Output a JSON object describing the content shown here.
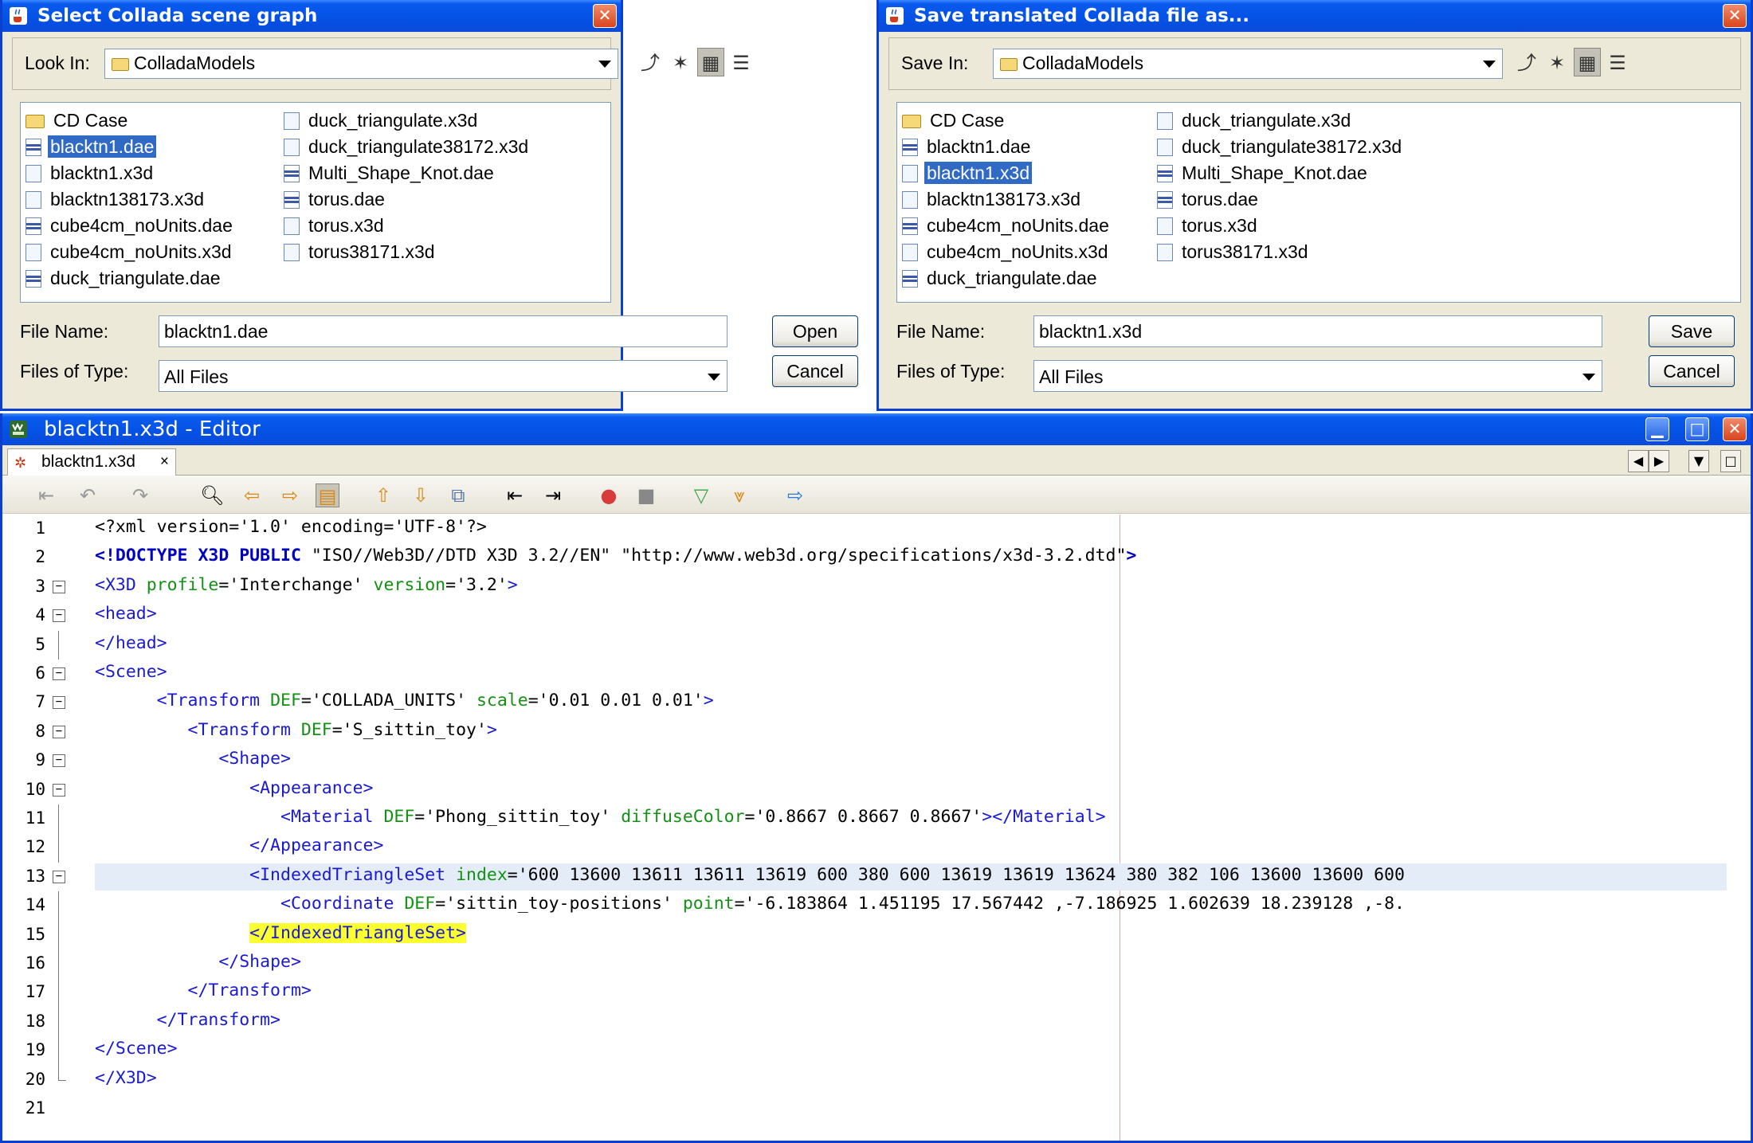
{
  "open_dialog": {
    "title": "Select Collada scene graph",
    "look_in_label": "Look In:",
    "look_in_value": "ColladaModels",
    "files_col1": [
      {
        "name": "CD Case",
        "type": "folder",
        "selected": false
      },
      {
        "name": "blacktn1.dae",
        "type": "dae",
        "selected": true
      },
      {
        "name": "blacktn1.x3d",
        "type": "x3d",
        "selected": false
      },
      {
        "name": "blacktn138173.x3d",
        "type": "x3d",
        "selected": false
      },
      {
        "name": "cube4cm_noUnits.dae",
        "type": "dae",
        "selected": false
      },
      {
        "name": "cube4cm_noUnits.x3d",
        "type": "x3d",
        "selected": false
      },
      {
        "name": "duck_triangulate.dae",
        "type": "dae",
        "selected": false
      }
    ],
    "files_col2": [
      {
        "name": "duck_triangulate.x3d",
        "type": "x3d",
        "selected": false
      },
      {
        "name": "duck_triangulate38172.x3d",
        "type": "x3d",
        "selected": false
      },
      {
        "name": "Multi_Shape_Knot.dae",
        "type": "dae",
        "selected": false
      },
      {
        "name": "torus.dae",
        "type": "dae",
        "selected": false
      },
      {
        "name": "torus.x3d",
        "type": "x3d",
        "selected": false
      },
      {
        "name": "torus38171.x3d",
        "type": "x3d",
        "selected": false
      }
    ],
    "file_name_label": "File Name:",
    "file_name_value": "blacktn1.dae",
    "files_of_type_label": "Files of Type:",
    "files_of_type_value": "All Files",
    "primary_button": "Open",
    "cancel_button": "Cancel"
  },
  "save_dialog": {
    "title": "Save translated Collada file as...",
    "look_in_label": "Save In:",
    "look_in_value": "ColladaModels",
    "files_col1": [
      {
        "name": "CD Case",
        "type": "folder",
        "selected": false
      },
      {
        "name": "blacktn1.dae",
        "type": "dae",
        "selected": false
      },
      {
        "name": "blacktn1.x3d",
        "type": "x3d",
        "selected": true
      },
      {
        "name": "blacktn138173.x3d",
        "type": "x3d",
        "selected": false
      },
      {
        "name": "cube4cm_noUnits.dae",
        "type": "dae",
        "selected": false
      },
      {
        "name": "cube4cm_noUnits.x3d",
        "type": "x3d",
        "selected": false
      },
      {
        "name": "duck_triangulate.dae",
        "type": "dae",
        "selected": false
      }
    ],
    "files_col2": [
      {
        "name": "duck_triangulate.x3d",
        "type": "x3d",
        "selected": false
      },
      {
        "name": "duck_triangulate38172.x3d",
        "type": "x3d",
        "selected": false
      },
      {
        "name": "Multi_Shape_Knot.dae",
        "type": "dae",
        "selected": false
      },
      {
        "name": "torus.dae",
        "type": "dae",
        "selected": false
      },
      {
        "name": "torus.x3d",
        "type": "x3d",
        "selected": false
      },
      {
        "name": "torus38171.x3d",
        "type": "x3d",
        "selected": false
      }
    ],
    "file_name_label": "File Name:",
    "file_name_value": "blacktn1.x3d",
    "files_of_type_label": "Files of Type:",
    "files_of_type_value": "All Files",
    "primary_button": "Save",
    "cancel_button": "Cancel"
  },
  "editor": {
    "title": "blacktn1.x3d - Editor",
    "tab_label": "blacktn1.x3d",
    "tab_close": "×",
    "highlight_color": "#FAFF30",
    "current_line": 13,
    "code_lines": [
      {
        "n": "1",
        "fold": "",
        "segments": [
          [
            "v",
            "<?xml version='1.0' encoding='UTF-8'?>"
          ]
        ]
      },
      {
        "n": "2",
        "fold": "",
        "segments": [
          [
            "b",
            "<!DOCTYPE X3D PUBLIC "
          ],
          [
            "v",
            "\"ISO//Web3D//DTD X3D 3.2//EN\" \"http://www.web3d.org/specifications/x3d-3.2.dtd\""
          ],
          [
            "b",
            ">"
          ]
        ]
      },
      {
        "n": "3",
        "fold": "minus",
        "segments": [
          [
            "t",
            "<X3D "
          ],
          [
            "a",
            "profile"
          ],
          [
            "v",
            "='Interchange' "
          ],
          [
            "a",
            "version"
          ],
          [
            "v",
            "='3.2'"
          ],
          [
            "t",
            ">"
          ]
        ]
      },
      {
        "n": "4",
        "fold": "minus",
        "segments": [
          [
            "t",
            "<head>"
          ]
        ]
      },
      {
        "n": "5",
        "fold": "line",
        "segments": [
          [
            "t",
            "</head>"
          ]
        ]
      },
      {
        "n": "6",
        "fold": "minus",
        "segments": [
          [
            "t",
            "<Scene>"
          ]
        ]
      },
      {
        "n": "7",
        "fold": "minus",
        "segments": [
          [
            "v",
            "      "
          ],
          [
            "t",
            "<Transform "
          ],
          [
            "a",
            "DEF"
          ],
          [
            "v",
            "='COLLADA_UNITS' "
          ],
          [
            "a",
            "scale"
          ],
          [
            "v",
            "='0.01 0.01 0.01'"
          ],
          [
            "t",
            ">"
          ]
        ]
      },
      {
        "n": "8",
        "fold": "minus",
        "segments": [
          [
            "v",
            "         "
          ],
          [
            "t",
            "<Transform "
          ],
          [
            "a",
            "DEF"
          ],
          [
            "v",
            "='S_sittin_toy'"
          ],
          [
            "t",
            ">"
          ]
        ]
      },
      {
        "n": "9",
        "fold": "minus",
        "segments": [
          [
            "v",
            "            "
          ],
          [
            "t",
            "<Shape>"
          ]
        ]
      },
      {
        "n": "10",
        "fold": "minus",
        "segments": [
          [
            "v",
            "               "
          ],
          [
            "t",
            "<Appearance>"
          ]
        ]
      },
      {
        "n": "11",
        "fold": "line",
        "segments": [
          [
            "v",
            "                  "
          ],
          [
            "t",
            "<Material "
          ],
          [
            "a",
            "DEF"
          ],
          [
            "v",
            "='Phong_sittin_toy' "
          ],
          [
            "a",
            "diffuseColor"
          ],
          [
            "v",
            "='0.8667 0.8667 0.8667'"
          ],
          [
            "t",
            "></Material>"
          ]
        ]
      },
      {
        "n": "12",
        "fold": "line",
        "segments": [
          [
            "v",
            "               "
          ],
          [
            "t",
            "</Appearance>"
          ]
        ]
      },
      {
        "n": "13",
        "fold": "minus",
        "segments": [
          [
            "v",
            "               "
          ],
          [
            "t",
            "<IndexedTriangleSet "
          ],
          [
            "a",
            "index"
          ],
          [
            "v",
            "='600 13600 13611 13611 13619 600 380 600 13619 13619 13624 380 382 106 13600 13600 600"
          ]
        ]
      },
      {
        "n": "14",
        "fold": "line",
        "segments": [
          [
            "v",
            "                  "
          ],
          [
            "t",
            "<Coordinate "
          ],
          [
            "a",
            "DEF"
          ],
          [
            "v",
            "='sittin_toy-positions' "
          ],
          [
            "a",
            "point"
          ],
          [
            "v",
            "='-6.183864 1.451195 17.567442 ,-7.186925 1.602639 18.239128 ,-8."
          ]
        ]
      },
      {
        "n": "15",
        "fold": "line",
        "segments": [
          [
            "v",
            "               "
          ],
          [
            "hl",
            "</IndexedTriangleSet>"
          ]
        ]
      },
      {
        "n": "16",
        "fold": "line",
        "segments": [
          [
            "v",
            "            "
          ],
          [
            "t",
            "</Shape>"
          ]
        ]
      },
      {
        "n": "17",
        "fold": "line",
        "segments": [
          [
            "v",
            "         "
          ],
          [
            "t",
            "</Transform>"
          ]
        ]
      },
      {
        "n": "18",
        "fold": "line",
        "segments": [
          [
            "v",
            "      "
          ],
          [
            "t",
            "</Transform>"
          ]
        ]
      },
      {
        "n": "19",
        "fold": "line",
        "segments": [
          [
            "t",
            "</Scene>"
          ]
        ]
      },
      {
        "n": "20",
        "fold": "end",
        "segments": [
          [
            "t",
            "</X3D>"
          ]
        ]
      },
      {
        "n": "21",
        "fold": "",
        "segments": []
      }
    ]
  }
}
